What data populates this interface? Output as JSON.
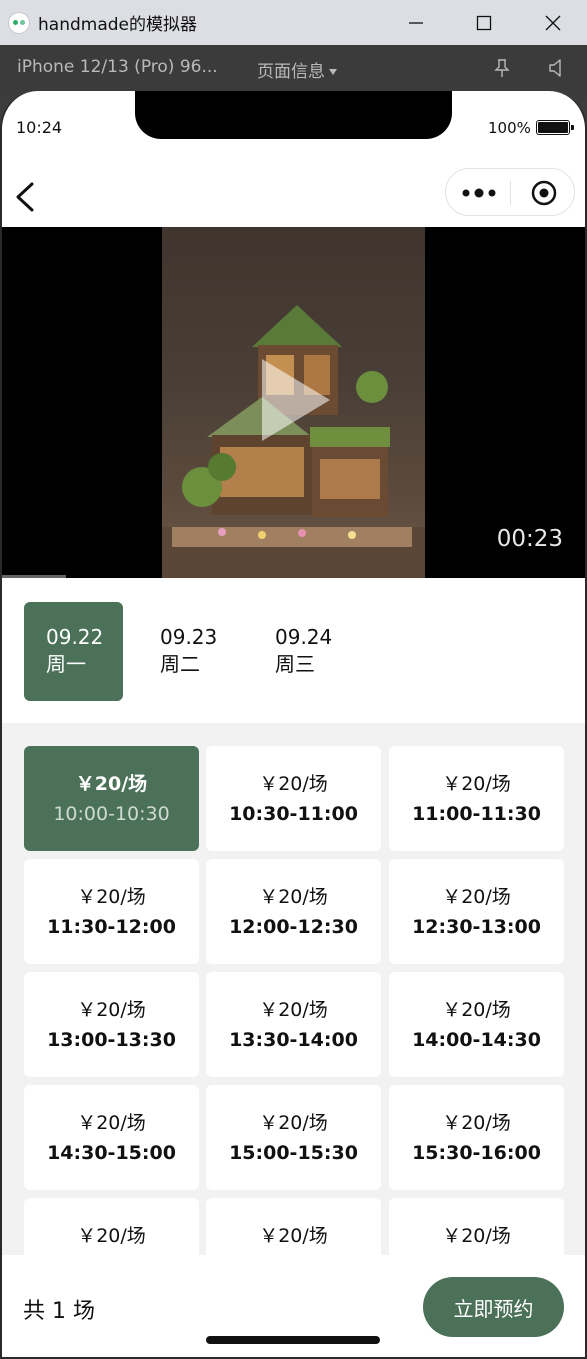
{
  "window": {
    "title": "handmade的模拟器"
  },
  "simulator": {
    "device": "iPhone 12/13 (Pro) 96...",
    "page_info": "页面信息"
  },
  "status_bar": {
    "time": "10:24",
    "battery": "100%"
  },
  "video": {
    "duration": "00:23",
    "progress_fraction": 0.11
  },
  "dates": [
    {
      "date": "09.22",
      "weekday": "周一",
      "selected": true
    },
    {
      "date": "09.23",
      "weekday": "周二",
      "selected": false
    },
    {
      "date": "09.24",
      "weekday": "周三",
      "selected": false
    }
  ],
  "slots": [
    {
      "price": "￥20/场",
      "time": "10:00-10:30",
      "selected": true
    },
    {
      "price": "￥20/场",
      "time": "10:30-11:00"
    },
    {
      "price": "￥20/场",
      "time": "11:00-11:30"
    },
    {
      "price": "￥20/场",
      "time": "11:30-12:00"
    },
    {
      "price": "￥20/场",
      "time": "12:00-12:30"
    },
    {
      "price": "￥20/场",
      "time": "12:30-13:00"
    },
    {
      "price": "￥20/场",
      "time": "13:00-13:30"
    },
    {
      "price": "￥20/场",
      "time": "13:30-14:00"
    },
    {
      "price": "￥20/场",
      "time": "14:00-14:30"
    },
    {
      "price": "￥20/场",
      "time": "14:30-15:00"
    },
    {
      "price": "￥20/场",
      "time": "15:00-15:30"
    },
    {
      "price": "￥20/场",
      "time": "15:30-16:00"
    },
    {
      "price": "￥20/场",
      "time": ""
    },
    {
      "price": "￥20/场",
      "time": ""
    },
    {
      "price": "￥20/场",
      "time": ""
    }
  ],
  "bottom": {
    "count_text": "共 1 场",
    "book_label": "立即预约"
  },
  "colors": {
    "accent": "#4b7158",
    "background": "#f2f2f2"
  }
}
